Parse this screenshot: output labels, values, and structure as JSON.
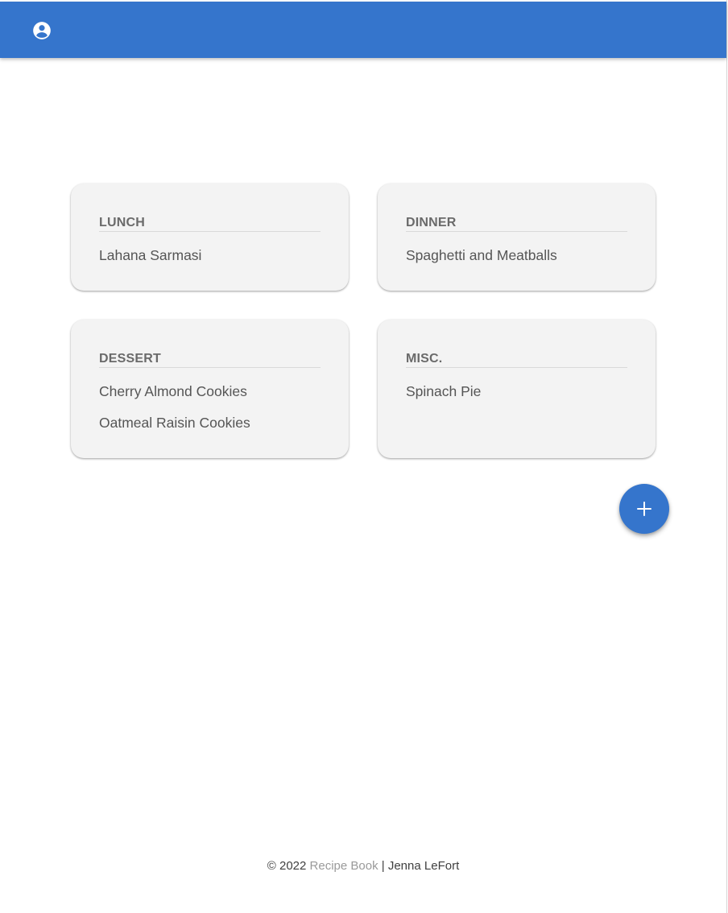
{
  "colors": {
    "app_bar": "#3575cc",
    "fab": "#3575cc",
    "card_background": "#f3f3f3",
    "title_text": "#6a6a6a",
    "recipe_text": "#555555",
    "footer_link": "#9a9a9a"
  },
  "header": {
    "account_icon": "account-circle-icon"
  },
  "categories": [
    {
      "title": "LUNCH",
      "recipes": [
        "Lahana Sarmasi"
      ]
    },
    {
      "title": "DINNER",
      "recipes": [
        "Spaghetti and Meatballs"
      ]
    },
    {
      "title": "DESSERT",
      "recipes": [
        "Cherry Almond Cookies",
        "Oatmeal Raisin Cookies"
      ]
    },
    {
      "title": "MISC.",
      "recipes": [
        "Spinach Pie"
      ]
    }
  ],
  "fab": {
    "icon": "plus-icon"
  },
  "footer": {
    "copyright": "© 2022",
    "brand": "Recipe Book",
    "separator": "|",
    "author": "Jenna LeFort"
  }
}
